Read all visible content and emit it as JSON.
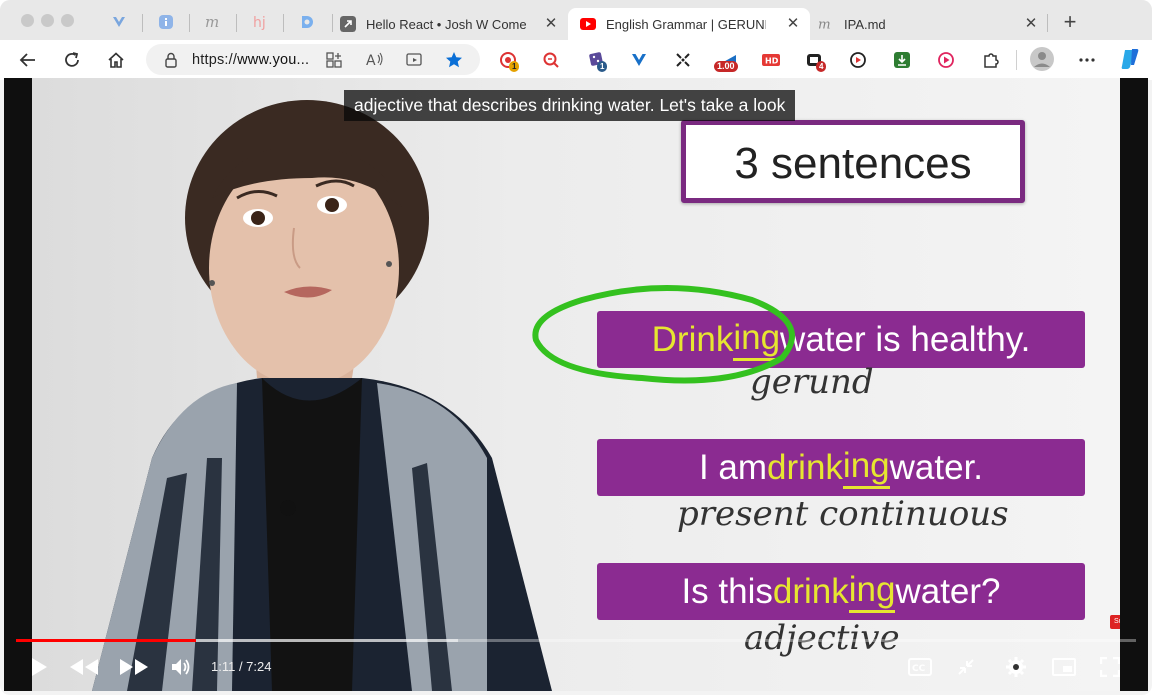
{
  "browser": {
    "tabs": [
      {
        "title": "Hello React • Josh W Comeau",
        "active": false
      },
      {
        "title": "English Grammar | GERUNDS in",
        "active": true
      },
      {
        "title": "IPA.md",
        "active": false
      }
    ],
    "new_tab_label": "+",
    "close_glyph": "✕",
    "url_prefix": "https://",
    "url_host": "www.you..."
  },
  "extensions": [
    {
      "icon": "record-extension-icon",
      "badge": "1"
    },
    {
      "icon": "search-zoom-extension-icon",
      "badge": ""
    },
    {
      "icon": "dice-extension-icon",
      "badge": "1"
    },
    {
      "icon": "v-logo-extension-icon",
      "badge": ""
    },
    {
      "icon": "arrows-extension-icon",
      "badge": ""
    },
    {
      "icon": "speed-extension-icon",
      "badge": "1.00"
    },
    {
      "icon": "hd-extension-icon",
      "badge": ""
    },
    {
      "icon": "game-extension-icon",
      "badge": "4"
    },
    {
      "icon": "video-capture-extension-icon",
      "badge": ""
    },
    {
      "icon": "download-extension-icon",
      "badge": ""
    },
    {
      "icon": "play-circle-extension-icon",
      "badge": ""
    },
    {
      "icon": "puzzle-icon",
      "badge": ""
    }
  ],
  "video": {
    "caption": "adjective that describes drinking water. Let's take a look",
    "slide_title": "3 sentences",
    "sentences": [
      {
        "pre": "",
        "hl_a": "Drink",
        "hl_b": "ing",
        "post": " water is healthy.",
        "note": "gerund"
      },
      {
        "pre": "I am ",
        "hl_a": "drink",
        "hl_b": "ing",
        "post": " water.",
        "note": "present continuous"
      },
      {
        "pre": "Is this ",
        "hl_a": "drink",
        "hl_b": "ing",
        "post": " water?",
        "note": "adjective"
      }
    ],
    "subscribe_label": "Subscribe",
    "time_label": "1:11 / 7:24",
    "progress": {
      "played": 0.161,
      "buffered": 0.395
    }
  },
  "colors": {
    "accent_purple": "#8b2b91",
    "highlight_yellow": "#e6e630",
    "circle_green": "#34c11f",
    "youtube_red": "#ff0000",
    "edge_blue": "#0a6fd6"
  }
}
